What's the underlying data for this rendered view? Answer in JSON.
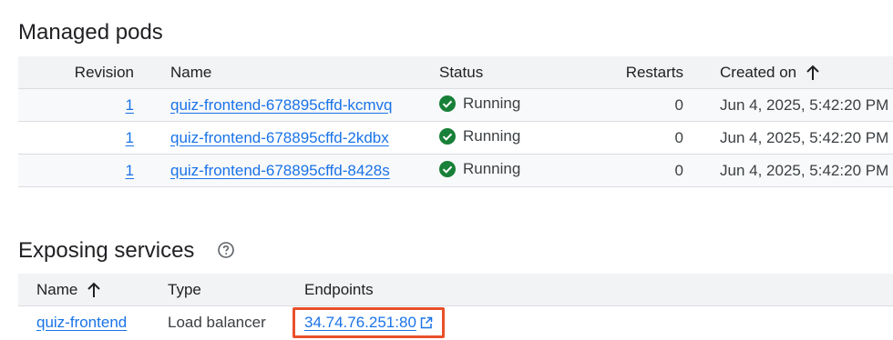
{
  "managed_pods": {
    "title": "Managed pods",
    "columns": {
      "revision": "Revision",
      "name": "Name",
      "status": "Status",
      "restarts": "Restarts",
      "created_on": "Created on"
    },
    "rows": [
      {
        "revision": "1",
        "name": "quiz-frontend-678895cffd-kcmvq",
        "status": "Running",
        "restarts": "0",
        "created_on": "Jun 4, 2025, 5:42:20 PM"
      },
      {
        "revision": "1",
        "name": "quiz-frontend-678895cffd-2kdbx",
        "status": "Running",
        "restarts": "0",
        "created_on": "Jun 4, 2025, 5:42:20 PM"
      },
      {
        "revision": "1",
        "name": "quiz-frontend-678895cffd-8428s",
        "status": "Running",
        "restarts": "0",
        "created_on": "Jun 4, 2025, 5:42:20 PM"
      }
    ]
  },
  "exposing_services": {
    "title": "Exposing services",
    "columns": {
      "name": "Name",
      "type": "Type",
      "endpoints": "Endpoints"
    },
    "rows": [
      {
        "name": "quiz-frontend",
        "type": "Load balancer",
        "endpoint": "34.74.76.251:80"
      }
    ]
  },
  "icons": {
    "status_ok": "check-circle-icon",
    "sort": "arrow-up-icon",
    "help": "help-circle-icon",
    "external_link": "open-in-new-icon"
  },
  "colors": {
    "link": "#1a73e8",
    "success": "#188038",
    "highlight": "#e8502a"
  }
}
